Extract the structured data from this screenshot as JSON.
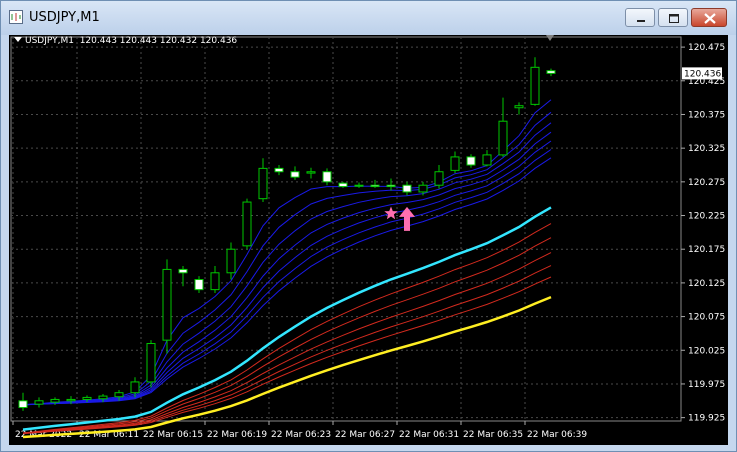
{
  "window": {
    "title": "USDJPY,M1"
  },
  "chart_header": {
    "symbol_label": "USDJPY,M1",
    "ohlc": "120.443 120.443 120.432 120.436"
  },
  "colors": {
    "background": "#000000",
    "grid": "#4a4a4a",
    "bull_candle": "#00c800",
    "bear_candle_fill": "#ffffff",
    "fast_ema": "#1a1ae6",
    "cyan_ema": "#33e6ff",
    "slow_ema": "#d22a1e",
    "yellow_ema": "#ffee22",
    "signal_arrow": "#ff6fb0"
  },
  "chart_data": {
    "type": "candlestick",
    "ylim": [
      119.92,
      120.49
    ],
    "price_axis": [
      "120.475",
      "120.425",
      "120.375",
      "120.325",
      "120.275",
      "120.225",
      "120.175",
      "120.125",
      "120.075",
      "120.025",
      "119.975",
      "119.925"
    ],
    "current_price_label": "120.436",
    "time_axis": [
      "22 Mar 2022",
      "22 Mar 06:11",
      "22 Mar 06:15",
      "22 Mar 06:19",
      "22 Mar 06:23",
      "22 Mar 06:27",
      "22 Mar 06:31",
      "22 Mar 06:35",
      "22 Mar 06:39"
    ],
    "candles": [
      {
        "o": 119.95,
        "h": 119.962,
        "l": 119.935,
        "c": 119.94
      },
      {
        "o": 119.945,
        "h": 119.955,
        "l": 119.94,
        "c": 119.95
      },
      {
        "o": 119.948,
        "h": 119.955,
        "l": 119.944,
        "c": 119.952
      },
      {
        "o": 119.95,
        "h": 119.957,
        "l": 119.945,
        "c": 119.952
      },
      {
        "o": 119.952,
        "h": 119.958,
        "l": 119.948,
        "c": 119.955
      },
      {
        "o": 119.953,
        "h": 119.96,
        "l": 119.948,
        "c": 119.957
      },
      {
        "o": 119.956,
        "h": 119.966,
        "l": 119.95,
        "c": 119.962
      },
      {
        "o": 119.962,
        "h": 119.985,
        "l": 119.955,
        "c": 119.978
      },
      {
        "o": 119.978,
        "h": 120.04,
        "l": 119.97,
        "c": 120.035
      },
      {
        "o": 120.04,
        "h": 120.16,
        "l": 120.02,
        "c": 120.145
      },
      {
        "o": 120.145,
        "h": 120.15,
        "l": 120.12,
        "c": 120.14
      },
      {
        "o": 120.13,
        "h": 120.135,
        "l": 120.11,
        "c": 120.115
      },
      {
        "o": 120.115,
        "h": 120.15,
        "l": 120.11,
        "c": 120.14
      },
      {
        "o": 120.14,
        "h": 120.185,
        "l": 120.13,
        "c": 120.175
      },
      {
        "o": 120.18,
        "h": 120.25,
        "l": 120.175,
        "c": 120.245
      },
      {
        "o": 120.25,
        "h": 120.31,
        "l": 120.245,
        "c": 120.295
      },
      {
        "o": 120.295,
        "h": 120.3,
        "l": 120.285,
        "c": 120.29
      },
      {
        "o": 120.29,
        "h": 120.298,
        "l": 120.278,
        "c": 120.282
      },
      {
        "o": 120.288,
        "h": 120.296,
        "l": 120.28,
        "c": 120.29
      },
      {
        "o": 120.29,
        "h": 120.295,
        "l": 120.27,
        "c": 120.275
      },
      {
        "o": 120.273,
        "h": 120.275,
        "l": 120.266,
        "c": 120.268
      },
      {
        "o": 120.27,
        "h": 120.274,
        "l": 120.266,
        "c": 120.27
      },
      {
        "o": 120.27,
        "h": 120.278,
        "l": 120.266,
        "c": 120.268
      },
      {
        "o": 120.27,
        "h": 120.28,
        "l": 120.262,
        "c": 120.268
      },
      {
        "o": 120.27,
        "h": 120.275,
        "l": 120.255,
        "c": 120.26
      },
      {
        "o": 120.26,
        "h": 120.275,
        "l": 120.255,
        "c": 120.27
      },
      {
        "o": 120.27,
        "h": 120.3,
        "l": 120.265,
        "c": 120.29
      },
      {
        "o": 120.292,
        "h": 120.32,
        "l": 120.288,
        "c": 120.312
      },
      {
        "o": 120.312,
        "h": 120.316,
        "l": 120.296,
        "c": 120.3
      },
      {
        "o": 120.3,
        "h": 120.322,
        "l": 120.298,
        "c": 120.315
      },
      {
        "o": 120.315,
        "h": 120.4,
        "l": 120.312,
        "c": 120.365
      },
      {
        "o": 120.385,
        "h": 120.393,
        "l": 120.375,
        "c": 120.388
      },
      {
        "o": 120.39,
        "h": 120.46,
        "l": 120.388,
        "c": 120.445
      },
      {
        "o": 120.44,
        "h": 120.443,
        "l": 120.432,
        "c": 120.436
      }
    ],
    "signal_arrow": {
      "bar_index": 24,
      "price": 120.22
    },
    "signal_star": {
      "bar_index": 23,
      "price": 120.228
    }
  }
}
